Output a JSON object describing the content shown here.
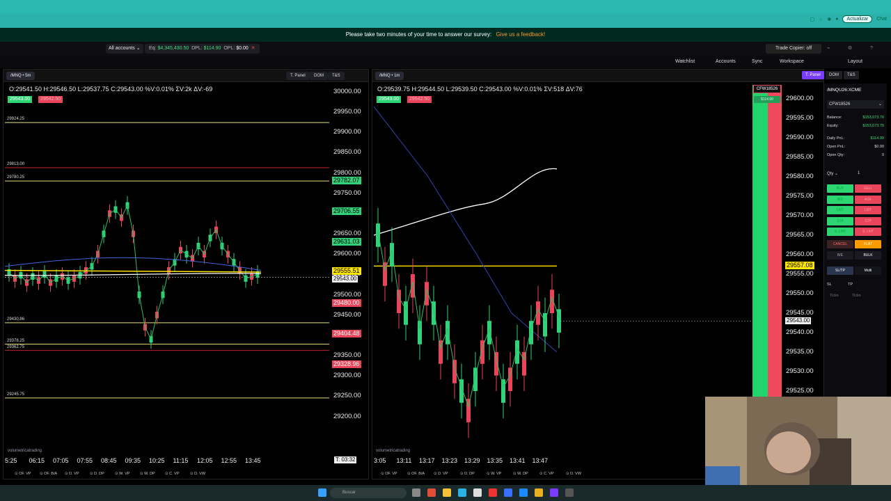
{
  "browser": {
    "update_label": "Actualizar",
    "chat_label": "Chat"
  },
  "survey": {
    "text": "Please take two minutes of your time to answer our survey:",
    "link": "Give us a feedback!"
  },
  "account_bar": {
    "account_select": "All accounts",
    "eq_label": "Eq:",
    "eq_value": "$4,345,430.50",
    "dpl_label": "DPL:",
    "dpl_value": "$114.90",
    "opl_label": "OPL:",
    "opl_value": "$0.00",
    "trade_copier": "Trade Copier: off"
  },
  "workspace_bar": {
    "watchlist": "Watchlist",
    "accounts": "Accounts",
    "sync": "Sync",
    "workspace": "Workspace",
    "layout": "Layout"
  },
  "chart_left": {
    "symbol": "/MNQ • 5m",
    "tabs": [
      "T. Panel",
      "DOM",
      "T&S"
    ],
    "ohlc": "O:29541.50  H:29546.50  L:29537.75  C:29543.00  %V:0.01%  ΣV:2k  ΔV:-69",
    "bid": "29543.00",
    "ask": "29542.50",
    "axis": [
      "30000.00",
      "29950.00",
      "29900.00",
      "29850.00",
      "29800.00",
      "29750.00",
      "29700.00",
      "29650.00",
      "29600.00",
      "29550.00",
      "29500.00",
      "29450.00",
      "29400.00",
      "29350.00",
      "29300.00",
      "29250.00",
      "29200.00"
    ],
    "levels": [
      "29924.25",
      "29813.00",
      "29780.25",
      "29430.86",
      "29378.25",
      "29362.75",
      "29245.75"
    ],
    "green_tags": [
      "29782.07",
      "29706.55",
      "29631.03"
    ],
    "red_tags": [
      "29480.00",
      "29404.48",
      "29328.96"
    ],
    "yellow_tag": "29555.51",
    "white_tag": "29543.00",
    "xlabels": [
      "5:25",
      "06:15",
      "07:05",
      "07:55",
      "08:45",
      "09:35",
      "10:25",
      "11:15",
      "12:05",
      "12:55",
      "13:45"
    ],
    "timer": "T: 03:32",
    "watermark": "volumetricatrading",
    "bottom": [
      "OF. VP",
      "OF. B/A",
      "D. VP",
      "D. DP",
      "W. VP",
      "W. DP",
      "C. VP",
      "D. VW"
    ]
  },
  "chart_right": {
    "symbol": "/MNQ • 1m",
    "tabs": [
      "T. Panel",
      "DOM",
      "T&S"
    ],
    "ohlc": "O:29539.75  H:29544.50  L:29539.50  C:29543.00  %V:0.01%  ΣV:518  ΔV:76",
    "bid": "29543.00",
    "ask": "29542.50",
    "axis": [
      "29600.00",
      "29595.00",
      "29590.00",
      "29585.00",
      "29580.00",
      "29575.00",
      "29570.00",
      "29565.00",
      "29560.00",
      "29555.00",
      "29550.00",
      "29545.00",
      "29540.00",
      "29535.00",
      "29530.00",
      "29525.00"
    ],
    "yellow_tag": "29557.08",
    "white_tag": "29543.00",
    "xlabels": [
      "3:05",
      "13:11",
      "13:17",
      "13:23",
      "13:29",
      "13:35",
      "13:41",
      "13:47"
    ],
    "watermark": "volumetricatrading",
    "account_badge": "CFW18526",
    "pnl_badge": "$114.90",
    "bottom": [
      "OF. VP",
      "OF. B/A",
      "D. VP",
      "D. DP",
      "W. VP",
      "W. DP",
      "C. VP",
      "D. VW"
    ]
  },
  "panel": {
    "symbol": "/MNQU26:XCME",
    "account": "CFW18526",
    "balance_label": "Balance:",
    "balance": "$153,073.70",
    "equity_label": "Equity:",
    "equity": "$153,073.70",
    "daily_label": "Daily PnL:",
    "daily": "$114.90",
    "open_label": "Open PnL:",
    "open": "$0.00",
    "openqty_label": "Open Qty:",
    "openqty": "0",
    "qty_label": "Qty",
    "qty": "1",
    "buttons": [
      [
        "BUY",
        "SELL"
      ],
      [
        "BID",
        "ASK"
      ],
      [
        "LMT",
        "LMT"
      ],
      [
        "STP",
        "STP"
      ],
      [
        "S. LMT",
        "S. LMT"
      ]
    ],
    "cancel": "CANCEL",
    "flat": "FLAT",
    "be": "B/E",
    "bulk": "BULK",
    "sltp": "SL/TP",
    "multi": "Multi",
    "sl": "SL",
    "tp": "TP",
    "ticks": "Ticks"
  },
  "taskbar": {
    "search": "Buscar"
  }
}
